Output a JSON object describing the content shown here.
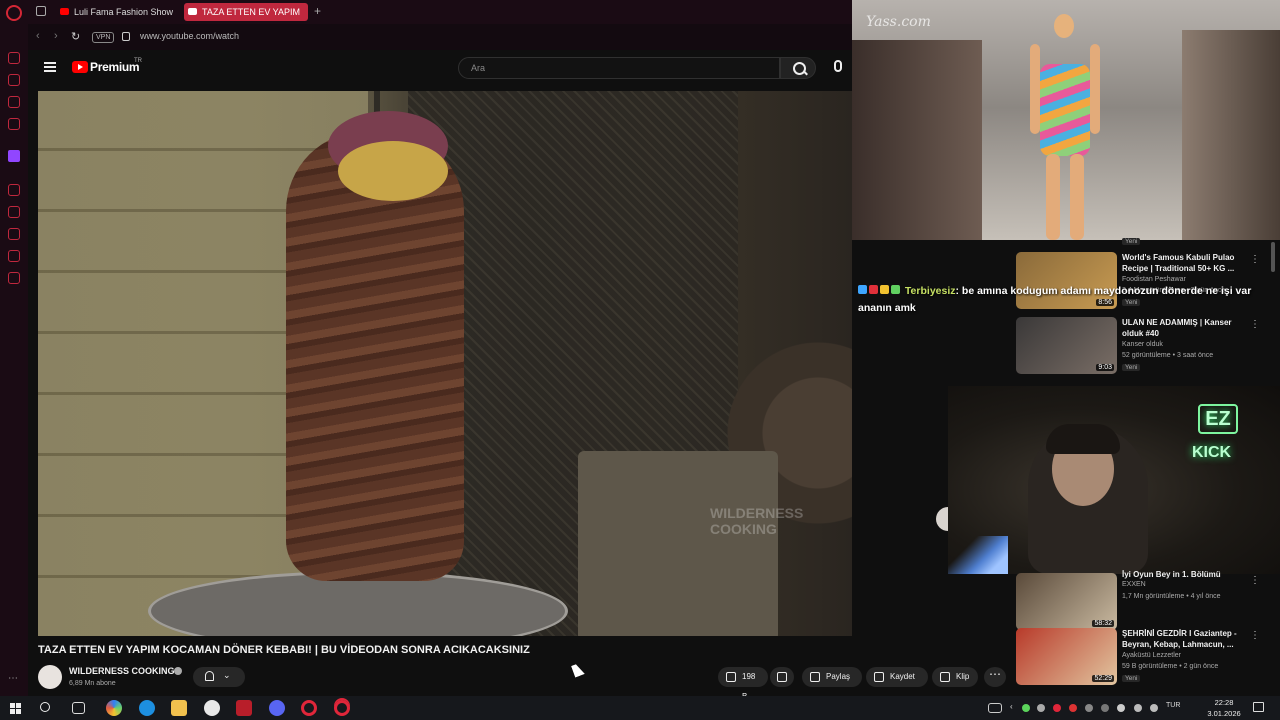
{
  "browser": {
    "tabs": [
      {
        "label": "Luli Fama Fashion Show S"
      },
      {
        "label": "TAZA ETTEN EV YAPIM"
      }
    ],
    "vpn_label": "VPN",
    "url": "www.youtube.com/watch"
  },
  "youtube": {
    "logo_text": "Premium",
    "region_badge": "TR",
    "search_placeholder": "Ara"
  },
  "video": {
    "watermark": "WILDERNESS COOKING",
    "title": "TAZA ETTEN EV YAPIM KOCAMAN DÖNER KEBABI! | BU VİDEODAN SONRA ACIKACAKSINIZ",
    "channel_name": "WILDERNESS COOKING",
    "subscribers": "6,89 Mn abone",
    "likes": "198 B",
    "share_label": "Paylaş",
    "save_label": "Kaydet",
    "clip_label": "Klip",
    "more_label": "⋯"
  },
  "overlay": {
    "runway_watermark": "Yass.com",
    "chat": {
      "username": "Terbiyesiz",
      "message": ": be amına kodugum adamı maydonozun dönerde ne işi var ananın amk"
    },
    "webcam_sign_1": "EZ",
    "webcam_sign_2": "KICK"
  },
  "suggestions": [
    {
      "title": "World's Famous Kabuli Pulao Recipe | Traditional 50+ KG ...",
      "channel": "Foodistan Peshawar",
      "meta": "3,4 Mn görüntüleme • 2 gün önce",
      "badge": "Yeni",
      "duration": "8:56",
      "menu": "⋮",
      "colors": [
        "#8a6a3a",
        "#c89b52"
      ]
    },
    {
      "title": "ULAN NE ADAMMIŞ | Kanser olduk #40",
      "channel": "Kanser olduk",
      "meta": "52 görüntüleme • 3 saat önce",
      "badge": "Yeni",
      "duration": "9:03",
      "menu": "⋮",
      "colors": [
        "#3a3838",
        "#7a6e66"
      ]
    },
    {
      "title": "İyi Oyun Bey in 1. Bölümü",
      "channel": "EXXEN",
      "meta": "1,7 Mn görüntüleme • 4 yıl önce",
      "badge": "",
      "duration": "58:32",
      "menu": "⋮",
      "colors": [
        "#5a4a3a",
        "#c9b9a0"
      ]
    },
    {
      "title": "ŞEHRİNİ GEZDİR I Gaziantep - Beyran, Kebap, Lahmacun, ...",
      "channel": "Ayaküstü Lezzetler",
      "meta": "59 B görüntüleme • 2 gün önce",
      "badge": "Yeni",
      "duration": "52:29",
      "menu": "⋮",
      "colors": [
        "#b83a2a",
        "#e2c6a0"
      ]
    }
  ],
  "top_suggestion_badge": "Yeni",
  "taskbar": {
    "language": "TUR",
    "time": "22:28",
    "date": "3.01.2026"
  }
}
